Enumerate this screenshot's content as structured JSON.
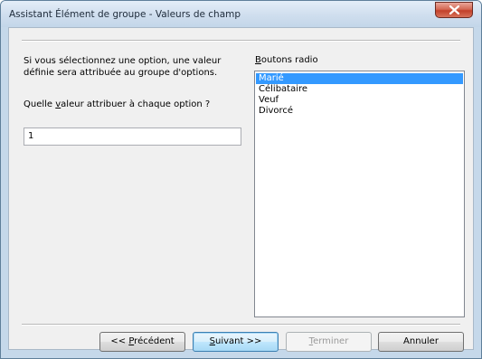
{
  "window": {
    "title": "Assistant Élément de groupe - Valeurs de champ"
  },
  "left": {
    "description_line1": "Si vous sélectionnez une option, une valeur",
    "description_line2": "définie sera attribuée au groupe d'options.",
    "question_pre": "Quelle ",
    "question_accel": "v",
    "question_post": "aleur attribuer à chaque option ?",
    "value_input": "1"
  },
  "right": {
    "label_accel": "B",
    "label_rest": "outons radio",
    "items": [
      {
        "label": "Marié",
        "selected": true
      },
      {
        "label": "Célibataire",
        "selected": false
      },
      {
        "label": "Veuf",
        "selected": false
      },
      {
        "label": "Divorcé",
        "selected": false
      }
    ]
  },
  "buttons": {
    "prev_pre": "<< ",
    "prev_accel": "P",
    "prev_post": "récédent",
    "next_accel": "S",
    "next_post": "uivant >>",
    "finish_accel": "T",
    "finish_post": "erminer",
    "cancel": "Annuler"
  },
  "colors": {
    "selection": "#3399ff",
    "close_button": "#c2402a"
  },
  "icons": {
    "close": "close-x-icon"
  }
}
